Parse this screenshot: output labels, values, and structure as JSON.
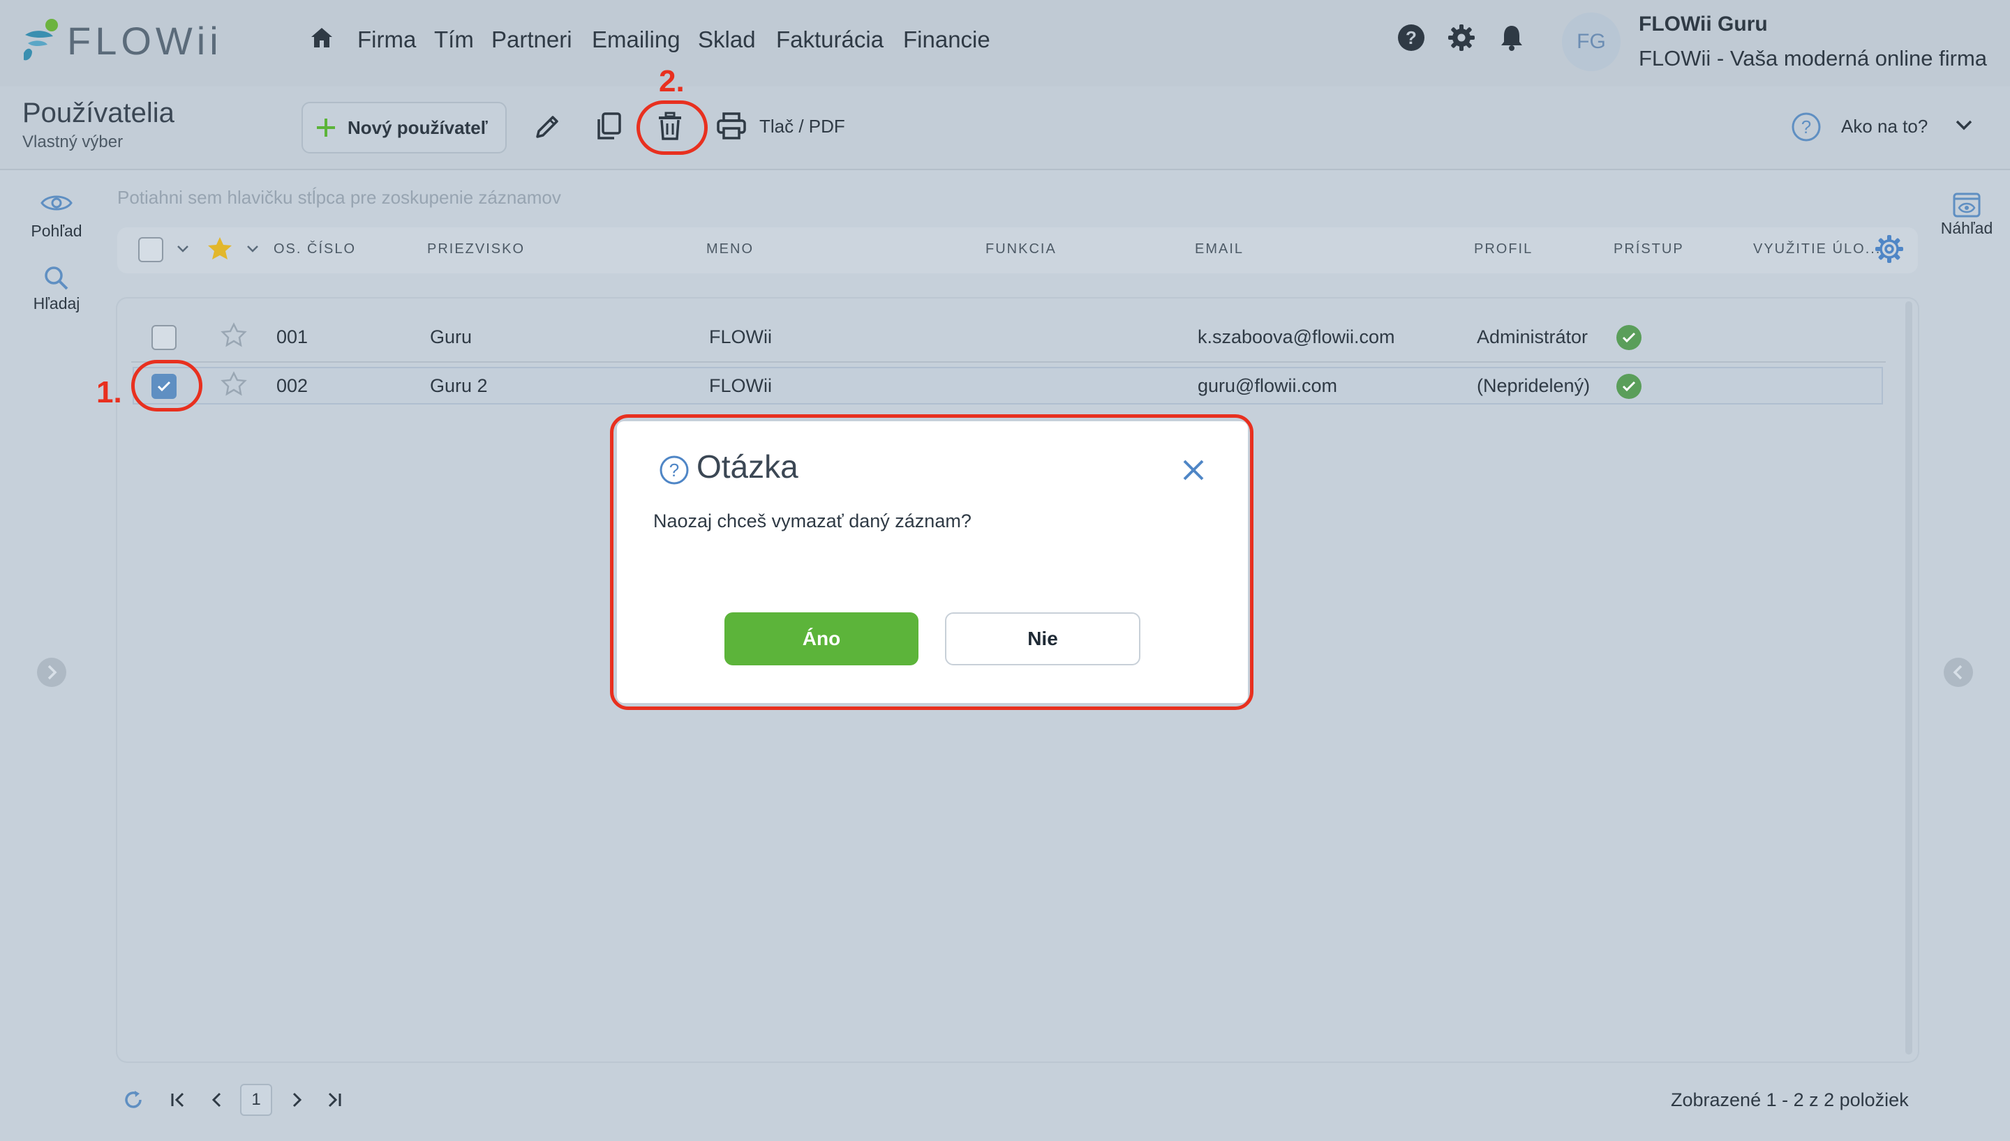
{
  "app": {
    "logo_text": "FLOWii",
    "brand_accent": "#5cb43a"
  },
  "nav": {
    "items": [
      "Firma",
      "Tím",
      "Partneri",
      "Emailing",
      "Sklad",
      "Fakturácia",
      "Financie"
    ]
  },
  "user": {
    "initials": "FG",
    "name": "FLOWii Guru",
    "company": "FLOWii - Vaša moderná online firma"
  },
  "page": {
    "title": "Používatelia",
    "subtitle": "Vlastný výber"
  },
  "toolbar": {
    "new_user_label": "Nový používateľ",
    "print_label": "Tlač / PDF",
    "howto_label": "Ako na to?"
  },
  "left_rail": {
    "view_label": "Pohľad",
    "search_label": "Hľadaj"
  },
  "right_rail": {
    "preview_label": "Náhľad"
  },
  "grid": {
    "group_hint": "Potiahni sem hlavičku stĺpca pre zoskupenie záznamov",
    "columns": [
      "OS. ČÍSLO",
      "PRIEZVISKO",
      "MENO",
      "FUNKCIA",
      "EMAIL",
      "PROFIL",
      "PRÍSTUP",
      "VYUŽITIE ÚLO..."
    ],
    "rows": [
      {
        "num": "001",
        "surname": "Guru",
        "name": "FLOWii",
        "function": "",
        "email": "k.szaboova@flowii.com",
        "profile": "Administrátor",
        "checked": false
      },
      {
        "num": "002",
        "surname": "Guru 2",
        "name": "FLOWii",
        "function": "",
        "email": "guru@flowii.com",
        "profile": "(Nepridelený)",
        "checked": true
      }
    ]
  },
  "pagination": {
    "current_page": "1",
    "status": "Zobrazené 1 - 2 z 2 položiek"
  },
  "dialog": {
    "title": "Otázka",
    "message": "Naozaj chceš vymazať daný záznam?",
    "yes_label": "Áno",
    "no_label": "Nie"
  },
  "annotations": {
    "step1": "1.",
    "step2": "2.",
    "color": "#e8301f"
  }
}
